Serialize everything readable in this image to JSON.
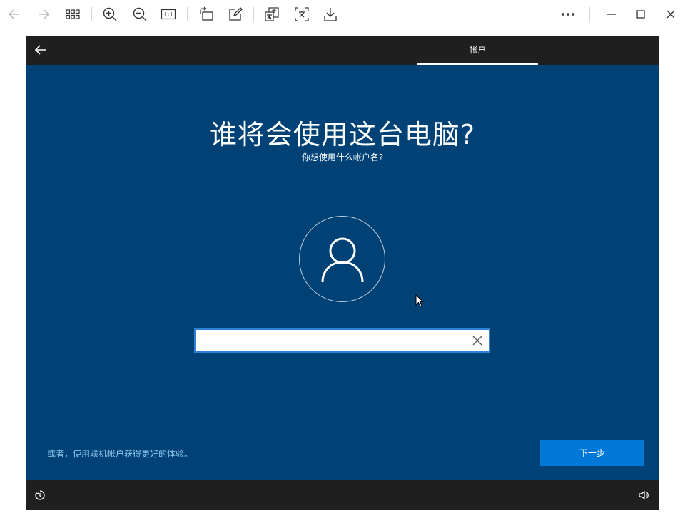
{
  "toolbar": {
    "icons": [
      "back-arrow-icon",
      "forward-arrow-icon",
      "grid-icon",
      "zoom-in-icon",
      "zoom-out-icon",
      "actual-size-icon",
      "rotate-icon",
      "edit-icon",
      "translate-icon",
      "text-extract-icon",
      "download-icon",
      "more-icon",
      "minimize-icon",
      "maximize-icon",
      "close-icon"
    ]
  },
  "oobe": {
    "tab_label": "帐户",
    "heading": "谁将会使用这台电脑?",
    "subheading": "你想使用什么帐户名?",
    "name_input": {
      "value": "",
      "placeholder": ""
    },
    "alt_link": "或者，使用联机帐户获得更好的体验。",
    "next_button": "下一步"
  },
  "colors": {
    "background": "#004275",
    "bar": "#1f1f1f",
    "accent": "#0078d7",
    "link": "#8fc6ef"
  }
}
